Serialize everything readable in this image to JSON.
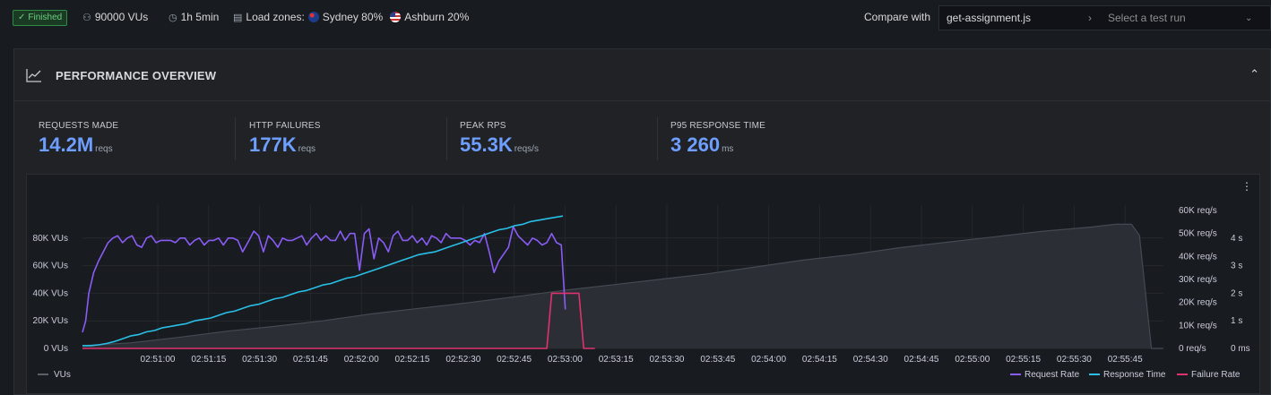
{
  "status": {
    "label": "Finished",
    "check_icon": "check-icon"
  },
  "run_info": {
    "vus": "90000 VUs",
    "duration": "1h 5min",
    "load_zones_label": "Load zones:",
    "zones": [
      {
        "name": "Sydney 80%",
        "flag": "australia-flag-icon"
      },
      {
        "name": "Ashburn 20%",
        "flag": "us-flag-icon"
      }
    ]
  },
  "compare": {
    "label": "Compare with",
    "script": "get-assignment.js",
    "separator": "›",
    "placeholder": "Select a test run",
    "chevron": "⌄"
  },
  "panel": {
    "title": "PERFORMANCE OVERVIEW",
    "collapse": "⌃",
    "menu": "⋮"
  },
  "stats": [
    {
      "label": "REQUESTS MADE",
      "value": "14.2M",
      "unit": "reqs"
    },
    {
      "label": "HTTP FAILURES",
      "value": "177K",
      "unit": "reqs"
    },
    {
      "label": "PEAK RPS",
      "value": "55.3K",
      "unit": "reqs/s"
    },
    {
      "label": "P95 RESPONSE TIME",
      "value": "3 260",
      "unit": "ms"
    }
  ],
  "colors": {
    "vus_area": "#444a53",
    "request_rate": "#8a5cf6",
    "response_time": "#29bfe6",
    "failure_rate": "#e0326e",
    "accent": "#6e9fff"
  },
  "chart_data": {
    "type": "line",
    "x_ticks": [
      "02:51:00",
      "02:51:15",
      "02:51:30",
      "02:51:45",
      "02:52:00",
      "02:52:15",
      "02:52:30",
      "02:52:45",
      "02:53:00",
      "02:53:15",
      "02:53:30",
      "02:53:45",
      "02:54:00",
      "02:54:15",
      "02:54:30",
      "02:54:45",
      "02:55:00",
      "02:55:15",
      "02:55:30",
      "02:55:45"
    ],
    "y_left_ticks": [
      "0 VUs",
      "20K VUs",
      "40K VUs",
      "60K VUs",
      "80K VUs"
    ],
    "y_left_range": [
      0,
      100000
    ],
    "y_mid_ticks": [
      "0 req/s",
      "10K req/s",
      "20K req/s",
      "30K req/s",
      "40K req/s",
      "50K req/s",
      "60K req/s"
    ],
    "y_mid_range": [
      0,
      60000
    ],
    "y_right_ticks": [
      "0 ms",
      "1 s",
      "2 s",
      "3 s",
      "4 s"
    ],
    "y_right_range": [
      0,
      5000
    ],
    "grid": true,
    "legend_position": "bottom",
    "series": [
      {
        "name": "VUs",
        "axis": "left",
        "style": "area",
        "points": [
          [
            0,
            2000
          ],
          [
            60,
            4000
          ],
          [
            120,
            8000
          ],
          [
            180,
            12500
          ],
          [
            240,
            16000
          ],
          [
            300,
            20000
          ],
          [
            360,
            25000
          ],
          [
            420,
            29000
          ],
          [
            480,
            33000
          ],
          [
            540,
            37500
          ],
          [
            600,
            42000
          ],
          [
            660,
            46000
          ],
          [
            720,
            50000
          ],
          [
            780,
            54000
          ],
          [
            840,
            59000
          ],
          [
            900,
            64000
          ],
          [
            960,
            68000
          ],
          [
            1020,
            73000
          ],
          [
            1080,
            77000
          ],
          [
            1140,
            81000
          ],
          [
            1200,
            85000
          ],
          [
            1260,
            88000
          ],
          [
            1290,
            90000
          ],
          [
            1310,
            90000
          ],
          [
            1320,
            82000
          ],
          [
            1335,
            0
          ],
          [
            1350,
            0
          ]
        ]
      },
      {
        "name": "Request Rate",
        "axis": "mid",
        "points": [
          [
            0,
            7000
          ],
          [
            4,
            12000
          ],
          [
            8,
            24000
          ],
          [
            14,
            33000
          ],
          [
            20,
            38000
          ],
          [
            26,
            42000
          ],
          [
            32,
            46000
          ],
          [
            38,
            48000
          ],
          [
            44,
            49000
          ],
          [
            50,
            46000
          ],
          [
            56,
            48000
          ],
          [
            62,
            49000
          ],
          [
            68,
            45000
          ],
          [
            74,
            44000
          ],
          [
            80,
            48000
          ],
          [
            86,
            49000
          ],
          [
            92,
            46000
          ],
          [
            98,
            47000
          ],
          [
            104,
            47000
          ],
          [
            110,
            47000
          ],
          [
            116,
            46000
          ],
          [
            122,
            48000
          ],
          [
            128,
            48000
          ],
          [
            134,
            45000
          ],
          [
            140,
            47000
          ],
          [
            146,
            48000
          ],
          [
            152,
            45000
          ],
          [
            158,
            47000
          ],
          [
            164,
            47000
          ],
          [
            170,
            48000
          ],
          [
            176,
            45000
          ],
          [
            182,
            48000
          ],
          [
            188,
            48000
          ],
          [
            194,
            47000
          ],
          [
            200,
            42000
          ],
          [
            208,
            47000
          ],
          [
            214,
            51000
          ],
          [
            220,
            49000
          ],
          [
            226,
            42000
          ],
          [
            232,
            49000
          ],
          [
            238,
            47000
          ],
          [
            244,
            44000
          ],
          [
            250,
            48000
          ],
          [
            256,
            47000
          ],
          [
            262,
            47000
          ],
          [
            268,
            48000
          ],
          [
            274,
            49000
          ],
          [
            280,
            45000
          ],
          [
            286,
            48000
          ],
          [
            292,
            50000
          ],
          [
            298,
            47000
          ],
          [
            304,
            49000
          ],
          [
            310,
            47000
          ],
          [
            316,
            47000
          ],
          [
            322,
            51000
          ],
          [
            328,
            47000
          ],
          [
            334,
            50000
          ],
          [
            340,
            50000
          ],
          [
            346,
            34000
          ],
          [
            352,
            50000
          ],
          [
            358,
            52000
          ],
          [
            364,
            39000
          ],
          [
            370,
            48000
          ],
          [
            376,
            46000
          ],
          [
            382,
            42000
          ],
          [
            388,
            49000
          ],
          [
            394,
            51000
          ],
          [
            400,
            47000
          ],
          [
            406,
            47000
          ],
          [
            412,
            49000
          ],
          [
            418,
            46000
          ],
          [
            424,
            48000
          ],
          [
            430,
            45000
          ],
          [
            436,
            49000
          ],
          [
            442,
            48000
          ],
          [
            448,
            46000
          ],
          [
            454,
            50000
          ],
          [
            460,
            48000
          ],
          [
            466,
            48000
          ],
          [
            472,
            48000
          ],
          [
            478,
            47000
          ],
          [
            484,
            45000
          ],
          [
            490,
            47000
          ],
          [
            496,
            46000
          ],
          [
            502,
            50000
          ],
          [
            508,
            42000
          ],
          [
            514,
            33000
          ],
          [
            520,
            38000
          ],
          [
            526,
            41000
          ],
          [
            532,
            44000
          ],
          [
            538,
            53000
          ],
          [
            544,
            49000
          ],
          [
            550,
            47000
          ],
          [
            556,
            45000
          ],
          [
            562,
            48000
          ],
          [
            568,
            47000
          ],
          [
            574,
            45000
          ],
          [
            580,
            46000
          ],
          [
            586,
            50000
          ],
          [
            592,
            46000
          ],
          [
            598,
            45000
          ],
          [
            603,
            17000
          ]
        ]
      },
      {
        "name": "Response Time",
        "axis": "right",
        "points": [
          [
            0,
            100
          ],
          [
            10,
            100
          ],
          [
            20,
            130
          ],
          [
            30,
            180
          ],
          [
            40,
            250
          ],
          [
            50,
            350
          ],
          [
            60,
            450
          ],
          [
            70,
            500
          ],
          [
            80,
            600
          ],
          [
            90,
            650
          ],
          [
            100,
            750
          ],
          [
            110,
            800
          ],
          [
            120,
            850
          ],
          [
            130,
            900
          ],
          [
            140,
            1000
          ],
          [
            150,
            1050
          ],
          [
            160,
            1100
          ],
          [
            170,
            1200
          ],
          [
            180,
            1300
          ],
          [
            190,
            1350
          ],
          [
            200,
            1450
          ],
          [
            210,
            1550
          ],
          [
            220,
            1600
          ],
          [
            230,
            1700
          ],
          [
            240,
            1800
          ],
          [
            250,
            1850
          ],
          [
            260,
            1950
          ],
          [
            270,
            2050
          ],
          [
            280,
            2100
          ],
          [
            290,
            2200
          ],
          [
            300,
            2300
          ],
          [
            310,
            2350
          ],
          [
            320,
            2450
          ],
          [
            330,
            2550
          ],
          [
            340,
            2600
          ],
          [
            350,
            2700
          ],
          [
            360,
            2800
          ],
          [
            370,
            2900
          ],
          [
            380,
            3000
          ],
          [
            390,
            3100
          ],
          [
            400,
            3200
          ],
          [
            410,
            3300
          ],
          [
            420,
            3400
          ],
          [
            430,
            3450
          ],
          [
            440,
            3500
          ],
          [
            450,
            3600
          ],
          [
            460,
            3700
          ],
          [
            470,
            3800
          ],
          [
            480,
            3900
          ],
          [
            490,
            4000
          ],
          [
            500,
            4100
          ],
          [
            510,
            4200
          ],
          [
            520,
            4300
          ],
          [
            530,
            4350
          ],
          [
            540,
            4450
          ],
          [
            550,
            4500
          ],
          [
            560,
            4600
          ],
          [
            570,
            4650
          ],
          [
            580,
            4700
          ],
          [
            590,
            4750
          ],
          [
            600,
            4800
          ]
        ]
      },
      {
        "name": "Failure Rate",
        "axis": "mid",
        "points": [
          [
            0,
            0
          ],
          [
            560,
            0
          ],
          [
            580,
            0
          ],
          [
            586,
            24000
          ],
          [
            620,
            24000
          ],
          [
            626,
            0
          ],
          [
            640,
            0
          ]
        ]
      }
    ],
    "legend": [
      "VUs",
      "Request Rate",
      "Response Time",
      "Failure Rate"
    ]
  }
}
